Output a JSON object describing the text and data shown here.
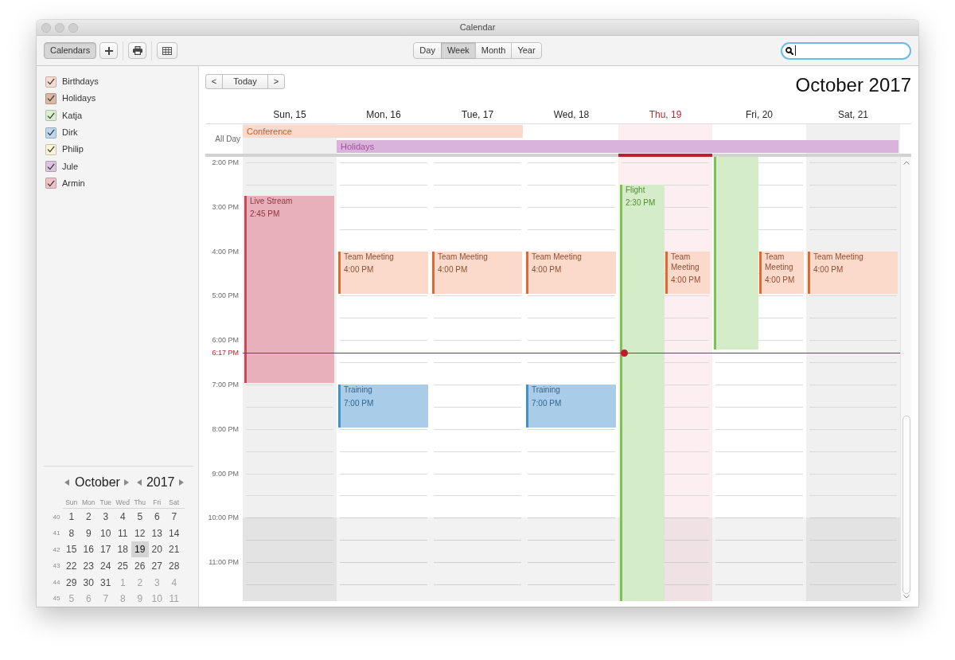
{
  "window": {
    "title": "Calendar"
  },
  "toolbar": {
    "calendars_button": {
      "label": "Calendars",
      "selected": true
    },
    "views": [
      {
        "label": "Day",
        "selected": false
      },
      {
        "label": "Week",
        "selected": true
      },
      {
        "label": "Month",
        "selected": false
      },
      {
        "label": "Year",
        "selected": false
      }
    ],
    "search": {
      "focused": true
    }
  },
  "sidebar": {
    "calendars": [
      {
        "name": "Birthdays",
        "checked": true,
        "color": "#f8dcd2"
      },
      {
        "name": "Holidays",
        "checked": true,
        "color": "#d9b8a6"
      },
      {
        "name": "Katja",
        "checked": true,
        "color": "#d9efcf"
      },
      {
        "name": "Dirk",
        "checked": true,
        "color": "#bcd8ee"
      },
      {
        "name": "Philip",
        "checked": true,
        "color": "#fff2d9"
      },
      {
        "name": "Jule",
        "checked": true,
        "color": "#dbc4de"
      },
      {
        "name": "Armin",
        "checked": true,
        "color": "#efc3c8"
      }
    ],
    "mini_calendar": {
      "month": "October",
      "year": "2017",
      "weekdays": [
        "Sun",
        "Mon",
        "Tue",
        "Wed",
        "Thu",
        "Fri",
        "Sat"
      ],
      "weeks": [
        {
          "number": "40",
          "days": [
            {
              "label": "1",
              "other_month": false,
              "selected": false
            },
            {
              "label": "2",
              "other_month": false,
              "selected": false
            },
            {
              "label": "3",
              "other_month": false,
              "selected": false
            },
            {
              "label": "4",
              "other_month": false,
              "selected": false
            },
            {
              "label": "5",
              "other_month": false,
              "selected": false
            },
            {
              "label": "6",
              "other_month": false,
              "selected": false
            },
            {
              "label": "7",
              "other_month": false,
              "selected": false
            }
          ]
        },
        {
          "number": "41",
          "days": [
            {
              "label": "8",
              "other_month": false,
              "selected": false
            },
            {
              "label": "9",
              "other_month": false,
              "selected": false
            },
            {
              "label": "10",
              "other_month": false,
              "selected": false
            },
            {
              "label": "11",
              "other_month": false,
              "selected": false
            },
            {
              "label": "12",
              "other_month": false,
              "selected": false
            },
            {
              "label": "13",
              "other_month": false,
              "selected": false
            },
            {
              "label": "14",
              "other_month": false,
              "selected": false
            }
          ]
        },
        {
          "number": "42",
          "days": [
            {
              "label": "15",
              "other_month": false,
              "selected": false
            },
            {
              "label": "16",
              "other_month": false,
              "selected": false
            },
            {
              "label": "17",
              "other_month": false,
              "selected": false
            },
            {
              "label": "18",
              "other_month": false,
              "selected": false
            },
            {
              "label": "19",
              "other_month": false,
              "selected": true
            },
            {
              "label": "20",
              "other_month": false,
              "selected": false
            },
            {
              "label": "21",
              "other_month": false,
              "selected": false
            }
          ]
        },
        {
          "number": "43",
          "days": [
            {
              "label": "22",
              "other_month": false,
              "selected": false
            },
            {
              "label": "23",
              "other_month": false,
              "selected": false
            },
            {
              "label": "24",
              "other_month": false,
              "selected": false
            },
            {
              "label": "25",
              "other_month": false,
              "selected": false
            },
            {
              "label": "26",
              "other_month": false,
              "selected": false
            },
            {
              "label": "27",
              "other_month": false,
              "selected": false
            },
            {
              "label": "28",
              "other_month": false,
              "selected": false
            }
          ]
        },
        {
          "number": "44",
          "days": [
            {
              "label": "29",
              "other_month": false,
              "selected": false
            },
            {
              "label": "30",
              "other_month": false,
              "selected": false
            },
            {
              "label": "31",
              "other_month": false,
              "selected": false
            },
            {
              "label": "1",
              "other_month": true,
              "selected": false
            },
            {
              "label": "2",
              "other_month": true,
              "selected": false
            },
            {
              "label": "3",
              "other_month": true,
              "selected": false
            },
            {
              "label": "4",
              "other_month": true,
              "selected": false
            }
          ]
        },
        {
          "number": "45",
          "days": [
            {
              "label": "5",
              "other_month": true,
              "selected": false
            },
            {
              "label": "6",
              "other_month": true,
              "selected": false
            },
            {
              "label": "7",
              "other_month": true,
              "selected": false
            },
            {
              "label": "8",
              "other_month": true,
              "selected": false
            },
            {
              "label": "9",
              "other_month": true,
              "selected": false
            },
            {
              "label": "10",
              "other_month": true,
              "selected": false
            },
            {
              "label": "11",
              "other_month": true,
              "selected": false
            }
          ]
        }
      ]
    }
  },
  "week_view": {
    "nav": {
      "previous": "<",
      "today": "Today",
      "next": ">"
    },
    "title": "October 2017",
    "days": [
      {
        "label": "Sun, 15",
        "today": false,
        "weekend": true,
        "events": [
          {
            "title": "Live Stream",
            "time": "2:45 PM",
            "color": "#e8b1b9"
          }
        ]
      },
      {
        "label": "Mon, 16",
        "today": false,
        "weekend": false,
        "events": [
          {
            "title": "Team Meeting",
            "time": "4:00 PM",
            "color": "#fcdacb"
          },
          {
            "title": "Training",
            "time": "7:00 PM",
            "color": "#a9cce9"
          }
        ]
      },
      {
        "label": "Tue, 17",
        "today": false,
        "weekend": false,
        "events": [
          {
            "title": "Team Meeting",
            "time": "4:00 PM",
            "color": "#fcdacb"
          }
        ]
      },
      {
        "label": "Wed, 18",
        "today": false,
        "weekend": false,
        "events": [
          {
            "title": "Team Meeting",
            "time": "4:00 PM",
            "color": "#fcdacb"
          },
          {
            "title": "Training",
            "time": "7:00 PM",
            "color": "#a9cce9"
          }
        ]
      },
      {
        "label": "Thu, 19",
        "today": true,
        "weekend": false,
        "events": [
          {
            "title": "Flight",
            "time": "2:30 PM",
            "color": "#d5ecc8"
          },
          {
            "title": "Team Meeting",
            "time": "4:00 PM",
            "color": "#fcdacb"
          }
        ]
      },
      {
        "label": "Fri, 20",
        "today": false,
        "weekend": false,
        "events": [
          {
            "color": "#d5ecc8"
          },
          {
            "title": "Team Meeting",
            "time": "4:00 PM",
            "color": "#fcdacb"
          }
        ]
      },
      {
        "label": "Sat, 21",
        "today": false,
        "weekend": true,
        "events": [
          {
            "title": "Team Meeting",
            "time": "4:00 PM",
            "color": "#fcdacb"
          }
        ]
      }
    ],
    "all_day": {
      "label": "All Day",
      "lanes": [
        {
          "cells": [
            {
              "kind": "start",
              "title": "Conference",
              "color": "#fcdacb"
            },
            {
              "kind": "continued"
            },
            {
              "kind": "continued"
            },
            {
              "kind": "free"
            },
            {
              "kind": "free"
            },
            {
              "kind": "free"
            },
            {
              "kind": "free"
            }
          ]
        },
        {
          "cells": [
            {
              "kind": "free"
            },
            {
              "kind": "start",
              "title": "Holidays",
              "color": "#d9b3d9"
            },
            {
              "kind": "continued"
            },
            {
              "kind": "continued"
            },
            {
              "kind": "continued"
            },
            {
              "kind": "continued"
            },
            {
              "kind": "continued"
            }
          ]
        }
      ]
    },
    "hours": [
      {
        "label": "2:00 PM",
        "off_hours": false
      },
      {
        "label": "3:00 PM",
        "off_hours": false
      },
      {
        "label": "4:00 PM",
        "off_hours": false
      },
      {
        "label": "5:00 PM",
        "off_hours": false
      },
      {
        "label": "6:00 PM",
        "off_hours": false
      },
      {
        "label": "7:00 PM",
        "off_hours": false
      },
      {
        "label": "8:00 PM",
        "off_hours": false
      },
      {
        "label": "9:00 PM",
        "off_hours": false
      },
      {
        "label": "10:00 PM",
        "off_hours": true
      },
      {
        "label": "11:00 PM",
        "off_hours": true
      }
    ],
    "now": {
      "label": "6:17 PM"
    }
  }
}
